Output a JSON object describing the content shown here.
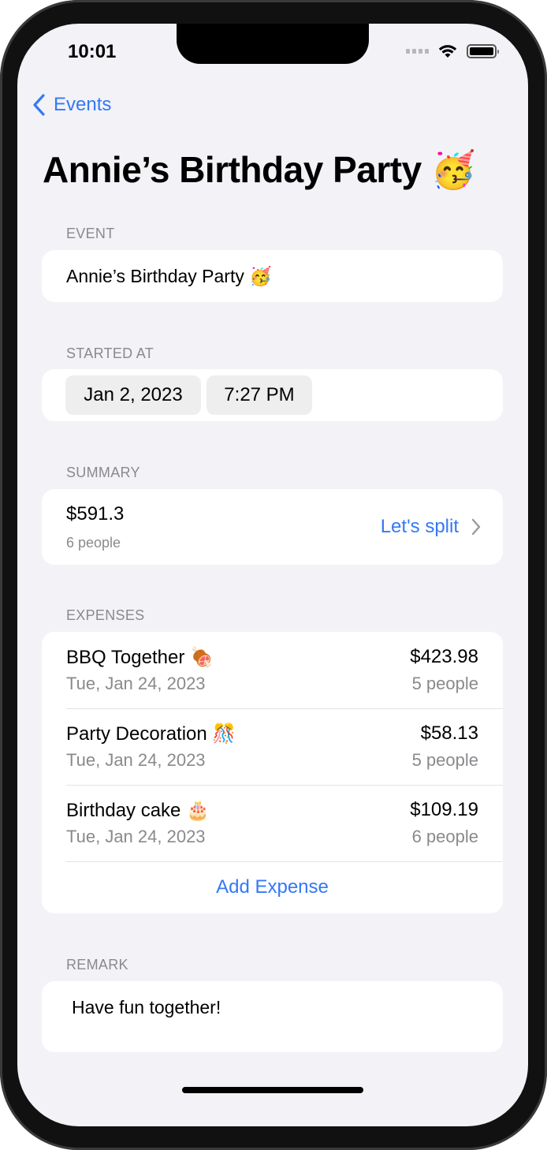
{
  "status_bar": {
    "time": "10:01"
  },
  "nav": {
    "back_label": "Events"
  },
  "page": {
    "title": "Annie’s Birthday Party 🥳"
  },
  "event_section": {
    "label": "EVENT",
    "value": "Annie’s Birthday Party 🥳"
  },
  "started_section": {
    "label": "STARTED AT",
    "date": "Jan 2, 2023",
    "time": "7:27 PM"
  },
  "summary_section": {
    "label": "SUMMARY",
    "total": "$591.3",
    "people": "6 people",
    "split_label": "Let's split"
  },
  "expenses_section": {
    "label": "EXPENSES",
    "items": [
      {
        "name": "BBQ Together 🍖",
        "date": "Tue, Jan 24, 2023",
        "amount": "$423.98",
        "people": "5 people"
      },
      {
        "name": "Party Decoration 🎊",
        "date": "Tue, Jan 24, 2023",
        "amount": "$58.13",
        "people": "5 people"
      },
      {
        "name": "Birthday cake 🎂",
        "date": "Tue, Jan 24, 2023",
        "amount": "$109.19",
        "people": "6 people"
      }
    ],
    "add_label": "Add Expense"
  },
  "remark_section": {
    "label": "REMARK",
    "value": "Have fun together!"
  },
  "colors": {
    "accent": "#3478f6",
    "background": "#f2f2f7",
    "secondary_text": "#8a8a8e"
  }
}
